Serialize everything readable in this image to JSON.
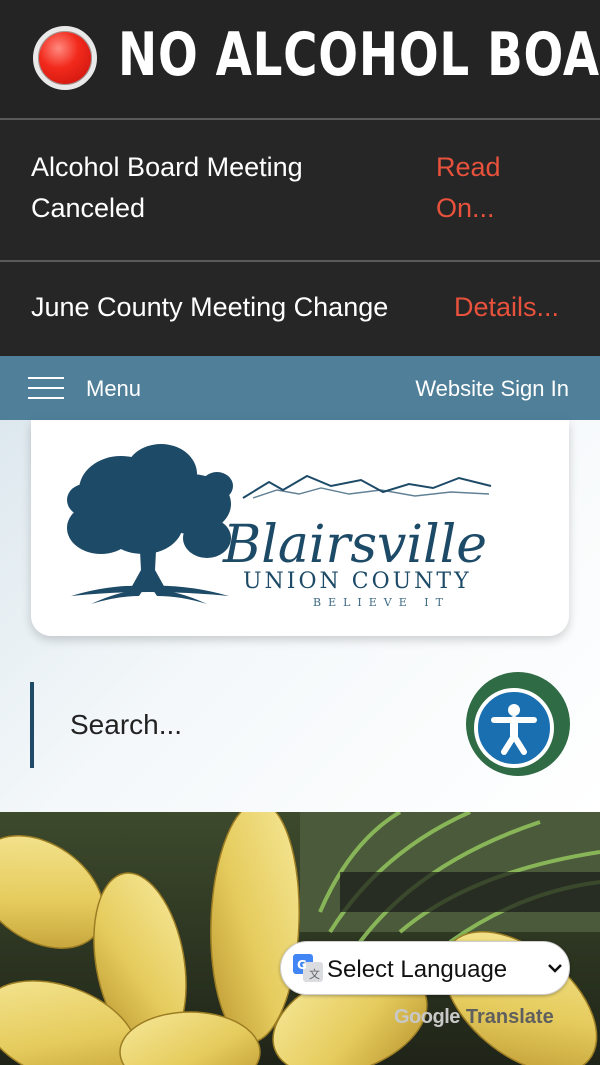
{
  "alert": {
    "title": "NO ALCOHOL BOARD MEETING",
    "icon": "red-alert-dot-icon",
    "colors": {
      "background": "#242424",
      "dot": "#f22a1c"
    }
  },
  "news": [
    {
      "title": "Alcohol Board Meeting Canceled",
      "link": "Read On..."
    },
    {
      "title": "June County Meeting Change",
      "link": "Details..."
    }
  ],
  "nav": {
    "menu_label": "Menu",
    "menu_icon": "hamburger-icon",
    "sign_in": "Website Sign In",
    "color": "#4f7f99"
  },
  "logo": {
    "script_name": "Blairsville",
    "county": "UNION COUNTY",
    "tagline": "BELIEVE IT",
    "color": "#1c4a67"
  },
  "search": {
    "placeholder": "Search..."
  },
  "accessibility": {
    "icon": "accessibility-person-icon"
  },
  "translate": {
    "select_label": "Select Language",
    "google": "Google",
    "translate": "Translate",
    "icon": "google-translate-icon"
  },
  "hero": {
    "image": "yellow-squash-photo"
  },
  "colors": {
    "link_red": "#e8513c",
    "nav_blue": "#4f7f99",
    "navy": "#1c4a67"
  }
}
